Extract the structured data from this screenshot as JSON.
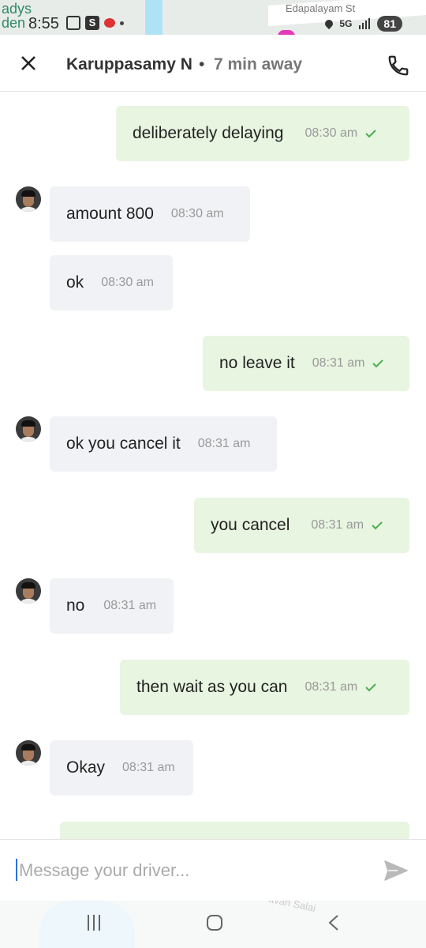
{
  "status_bar": {
    "map_labels": [
      "ady s",
      "den"
    ],
    "city_top": "adys",
    "city_bottom": "den",
    "street": "Edapalayam St",
    "time": "8:55",
    "network": "5G",
    "battery": "81"
  },
  "header": {
    "driver_name": "Karuppasamy N",
    "separator": "•",
    "eta": "7 min away"
  },
  "messages": [
    {
      "dir": "out",
      "text": "deliberately delaying",
      "time": "08:30 am"
    },
    {
      "dir": "in",
      "text": "amount 800",
      "time": "08:30 am"
    },
    {
      "dir": "in",
      "text": "ok",
      "time": "08:30 am"
    },
    {
      "dir": "out",
      "text": "no leave it",
      "time": "08:31 am"
    },
    {
      "dir": "in",
      "text": "ok you cancel it",
      "time": "08:31 am"
    },
    {
      "dir": "out",
      "text": "you cancel",
      "time": "08:31 am"
    },
    {
      "dir": "in",
      "text": "no",
      "time": "08:31 am"
    },
    {
      "dir": "out",
      "text": "then wait as you can",
      "time": "08:31 am"
    },
    {
      "dir": "in",
      "text": "Okay",
      "time": "08:31 am"
    }
  ],
  "input": {
    "placeholder": "Message your driver...",
    "value": ""
  },
  "navbar": {
    "map_label": "avan Salai"
  },
  "colors": {
    "outgoing_bubble": "#e8f5e1",
    "incoming_bubble": "#f1f2f5",
    "tick": "#4caf50",
    "caret": "#2d6fd8"
  }
}
